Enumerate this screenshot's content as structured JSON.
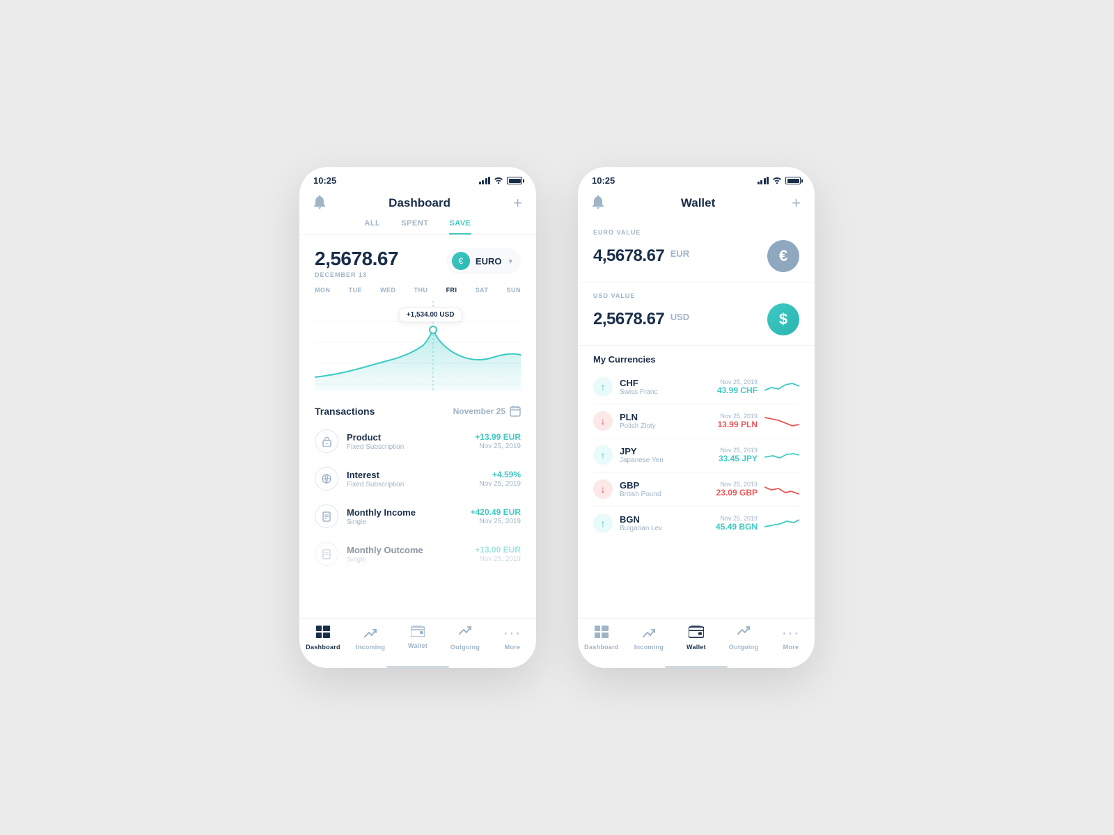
{
  "phone1": {
    "status_time": "10:25",
    "header_title": "Dashboard",
    "tabs": [
      "ALL",
      "SPENT",
      "SAVE"
    ],
    "active_tab": "SAVE",
    "main_amount": "2,5678.67",
    "amount_date": "DECEMBER 13",
    "currency_symbol": "€",
    "currency_label": "EURO",
    "chart_days": [
      "MON",
      "TUE",
      "WED",
      "THU",
      "FRI",
      "SAT",
      "SUN"
    ],
    "active_day": "FRI",
    "tooltip": "+1,534.00 USD",
    "transactions_title": "Transactions",
    "transactions_date": "November 25",
    "transactions": [
      {
        "icon": "🔒",
        "name": "Product",
        "sub": "Fixed Subscription",
        "amount": "+13.99 EUR",
        "date": "Nov 25, 2019"
      },
      {
        "icon": "🌐",
        "name": "Interest",
        "sub": "Fixed Subscription",
        "amount": "+4.59%",
        "date": "Nov 25, 2019"
      },
      {
        "icon": "📋",
        "name": "Monthly Income",
        "sub": "Single",
        "amount": "+420.49 EUR",
        "date": "Nov 25, 2019"
      },
      {
        "icon": "📋",
        "name": "Monthly Outcome",
        "sub": "Single",
        "amount": "+13.00 EUR",
        "date": "Nov 25, 2019"
      }
    ],
    "nav": [
      {
        "label": "Dashboard",
        "active": true
      },
      {
        "label": "Incoming",
        "active": false
      },
      {
        "label": "Wallet",
        "active": false
      },
      {
        "label": "Outgoing",
        "active": false
      },
      {
        "label": "More",
        "active": false
      }
    ]
  },
  "phone2": {
    "status_time": "10:25",
    "header_title": "Wallet",
    "euro_label": "EURO VALUE",
    "euro_amount": "4,5678.67",
    "euro_currency": "EUR",
    "usd_label": "USD VALUE",
    "usd_amount": "2,5678.67",
    "usd_currency": "USD",
    "currencies_title": "My Currencies",
    "currencies": [
      {
        "code": "CHF",
        "name": "Swiss Franc",
        "date": "Nov 25, 2019",
        "value": "43.99 CHF",
        "trend": "up"
      },
      {
        "code": "PLN",
        "name": "Polish Zloty",
        "date": "Nov 25, 2019",
        "value": "13.99 PLN",
        "trend": "down"
      },
      {
        "code": "JPY",
        "name": "Japanese Yen",
        "date": "Nov 25, 2019",
        "value": "33.45 JPY",
        "trend": "up"
      },
      {
        "code": "GBP",
        "name": "British Pound",
        "date": "Nov 25, 2019",
        "value": "23.09 GBP",
        "trend": "down"
      },
      {
        "code": "BGN",
        "name": "Bulgarian Lev",
        "date": "Nov 25, 2019",
        "value": "45.49 BGN",
        "trend": "up"
      }
    ],
    "nav": [
      {
        "label": "Dashboard",
        "active": false
      },
      {
        "label": "Incoming",
        "active": false
      },
      {
        "label": "Wallet",
        "active": true
      },
      {
        "label": "Outgoing",
        "active": false
      },
      {
        "label": "More",
        "active": false
      }
    ]
  }
}
